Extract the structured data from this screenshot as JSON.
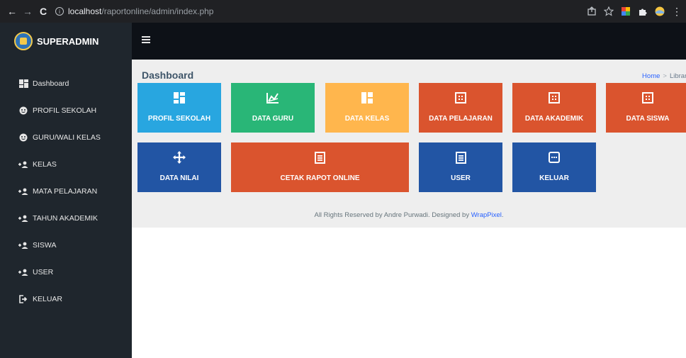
{
  "browser": {
    "url_host": "localhost",
    "url_path": "/raportonline/admin/index.php"
  },
  "sidebar": {
    "brand": "SUPERADMIN",
    "items": [
      {
        "label": "Dashboard",
        "icon": "dashboard-icon"
      },
      {
        "label": "PROFIL SEKOLAH",
        "icon": "face-icon"
      },
      {
        "label": "GURU/WALI KELAS",
        "icon": "face-icon"
      },
      {
        "label": "KELAS",
        "icon": "account-group-icon"
      },
      {
        "label": "MATA PELAJARAN",
        "icon": "account-group-icon"
      },
      {
        "label": "TAHUN AKADEMIK",
        "icon": "account-group-icon"
      },
      {
        "label": "SISWA",
        "icon": "account-group-icon"
      },
      {
        "label": "USER",
        "icon": "account-group-icon"
      },
      {
        "label": "KELUAR",
        "icon": "logout-icon"
      }
    ]
  },
  "main": {
    "title": "Dashboard",
    "breadcrumb": {
      "home": "Home",
      "current": "Library"
    },
    "tiles": [
      {
        "label": "PROFIL SEKOLAH",
        "color": "#28a6e0"
      },
      {
        "label": "DATA GURU",
        "color": "#29b677"
      },
      {
        "label": "DATA KELAS",
        "color": "#ffb64d"
      },
      {
        "label": "DATA PELAJARAN",
        "color": "#da542e"
      },
      {
        "label": "DATA AKADEMIK",
        "color": "#da542e"
      },
      {
        "label": "DATA SISWA",
        "color": "#da542e"
      },
      {
        "label": "DATA NILAI",
        "color": "#2255a4"
      },
      {
        "label": "CETAK RAPOT ONLINE",
        "color": "#da542e"
      },
      {
        "label": "USER",
        "color": "#2255a4"
      },
      {
        "label": "KELUAR",
        "color": "#2255a4"
      }
    ],
    "footer": {
      "text": "All Rights Reserved by Andre Purwadi. Designed by ",
      "link": "WrapPixel",
      "end": "."
    }
  }
}
